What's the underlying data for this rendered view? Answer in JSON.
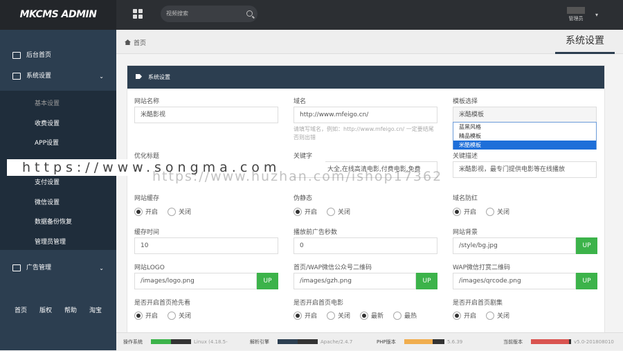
{
  "topbar": {
    "logo": "MKCMS ADMIN",
    "search_placeholder": "视频搜索",
    "user_name": "管理员"
  },
  "sidebar": {
    "items": [
      {
        "label": "后台首页",
        "icon": "laptop-icon"
      },
      {
        "label": "系统设置",
        "icon": "edit-icon"
      },
      {
        "label": "广告管理",
        "icon": "card-icon"
      }
    ],
    "sub_items": [
      "基本设置",
      "收费设置",
      "APP设置",
      "",
      "支付设置",
      "微信设置",
      "数据备份恢复",
      "管理员管理"
    ],
    "footer_links": [
      "首页",
      "版权",
      "帮助",
      "淘宝"
    ]
  },
  "breadcrumb": {
    "home": "首页"
  },
  "page_title": "系统设置",
  "panel": {
    "title": "系统设置",
    "fields": {
      "site_name": {
        "label": "网站名称",
        "value": "米酷影视"
      },
      "domain": {
        "label": "域名",
        "value": "http://www.mfeigo.cn/",
        "hint": "请填写域名，例如：http://www.mfeigo.cn/ 一定要结尾否则出错"
      },
      "template": {
        "label": "模板选择",
        "value": "米酷模板",
        "options": [
          "蓝黑风格",
          "精品模板",
          "米酷模板"
        ]
      },
      "seo_title": {
        "label": "优化标题"
      },
      "keywords": {
        "label": "关键字",
        "value": "大全,在线高清电影,付费电影,免费"
      },
      "description": {
        "label": "关键描述",
        "value": "米酷影视，最专门提供电影等在线播放"
      },
      "site_cache": {
        "label": "网站缓存",
        "on": "开启",
        "off": "关闭"
      },
      "pseudo_static": {
        "label": "伪静态",
        "on": "开启",
        "off": "关闭"
      },
      "domain_redirect": {
        "label": "域名防红",
        "on": "开启",
        "off": "关闭"
      },
      "cache_time": {
        "label": "缓存时间",
        "value": "10"
      },
      "ad_seconds": {
        "label": "播放前广告秒数",
        "value": "0"
      },
      "bg": {
        "label": "网站背景",
        "value": "/style/bg.jpg",
        "btn": "UP"
      },
      "logo": {
        "label": "网站LOGO",
        "value": "/images/logo.png",
        "btn": "UP"
      },
      "qr_wechat": {
        "label": "首页/WAP微信公众号二维码",
        "value": "/images/gzh.png",
        "btn": "UP"
      },
      "qr_wap": {
        "label": "WAP微信打赏二维码",
        "value": "/images/qrcode.png",
        "btn": "UP"
      },
      "home_grab": {
        "label": "是否开启首页抢先看",
        "on": "开启",
        "off": "关闭"
      },
      "home_movie": {
        "label": "是否开启首页电影",
        "on": "开启",
        "off": "关闭",
        "newest": "最新",
        "hot": "最热"
      },
      "home_drama": {
        "label": "是否开启首页剧集",
        "on": "开启",
        "off": "关闭"
      }
    }
  },
  "status": [
    {
      "label": "操作系统",
      "value": "Linux (4.18.5-",
      "color": "#3cb34a",
      "fill_percent": 50
    },
    {
      "label": "解析引擎",
      "value": "Apache/2.4.7",
      "color": "#2c3e50",
      "fill_percent": 50
    },
    {
      "label": "PHP版本",
      "value": "5.6.39",
      "color": "#f0ad4e",
      "fill_percent": 70
    },
    {
      "label": "当前版本",
      "value": "v5.0-201808010",
      "color": "#d9534f",
      "fill_percent": 95
    }
  ],
  "watermark": {
    "text1": "https://www.songma.com",
    "text2": "https://www.huzhan.com/ishop17362"
  }
}
